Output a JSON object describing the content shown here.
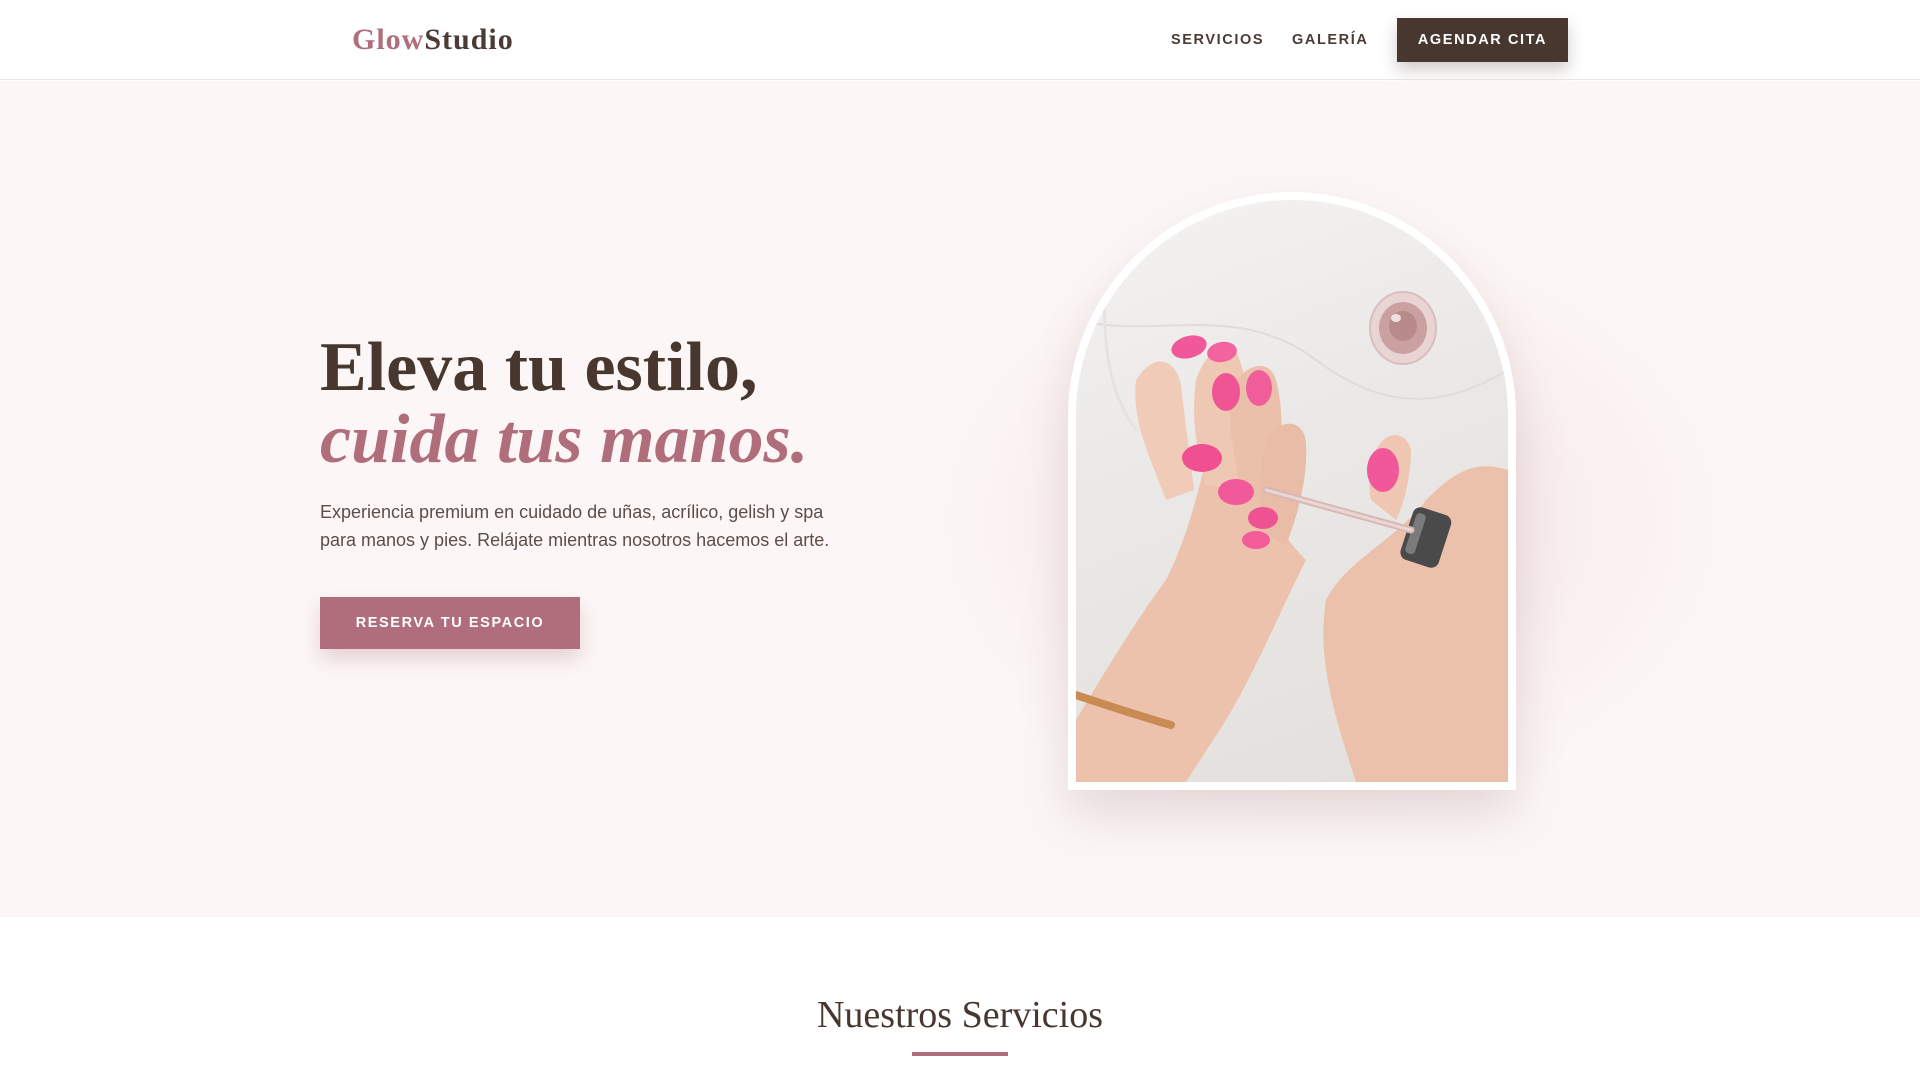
{
  "header": {
    "logo_part1": "Glow",
    "logo_part2": "Studio",
    "nav": {
      "services": "SERVICIOS",
      "gallery": "GALERÍA",
      "book": "AGENDAR CITA"
    }
  },
  "hero": {
    "title_line1": "Eleva tu estilo,",
    "title_line2": "cuida tus manos.",
    "description": "Experiencia premium en cuidado de uñas, acrílico, gelish y spa para manos y pies. Relájate mientras nosotros hacemos el arte.",
    "cta": "RESERVA TU ESPACIO",
    "image_icon": "manicure-photo"
  },
  "services": {
    "title": "Nuestros Servicios"
  },
  "colors": {
    "brand_rose": "#b06d7b",
    "brand_dark": "#47372f",
    "hero_background": "#fcf7f6",
    "nail_pink": "#f0589a"
  }
}
